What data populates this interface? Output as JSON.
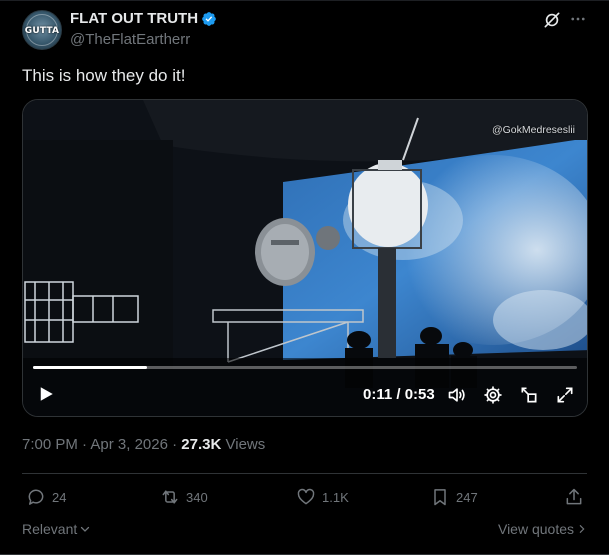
{
  "author": {
    "display_name": "FLAT OUT TRUTH",
    "handle": "@TheFlatEartherr",
    "avatar_text": "GUTTA",
    "verified": true,
    "verified_color": "#1d9bf0"
  },
  "tweet": {
    "text": "This is how they do it!"
  },
  "video": {
    "watermark": "@GokMedreseslii",
    "current_time": "0:11",
    "duration": "0:53",
    "time_display": "0:11 / 0:53",
    "progress": 0.21
  },
  "meta": {
    "time": "7:00 PM",
    "date": "Apr 3, 2026",
    "views_count": "27.3K",
    "views_label": "Views",
    "separator": "·"
  },
  "actions": {
    "replies": "24",
    "reposts": "340",
    "likes": "1.1K",
    "bookmarks": "247"
  },
  "footer": {
    "sort_label": "Relevant",
    "quotes_label": "View quotes"
  },
  "colors": {
    "background": "#000000",
    "text_primary": "#e7e9ea",
    "text_secondary": "#71767b",
    "border": "#2f3336"
  }
}
